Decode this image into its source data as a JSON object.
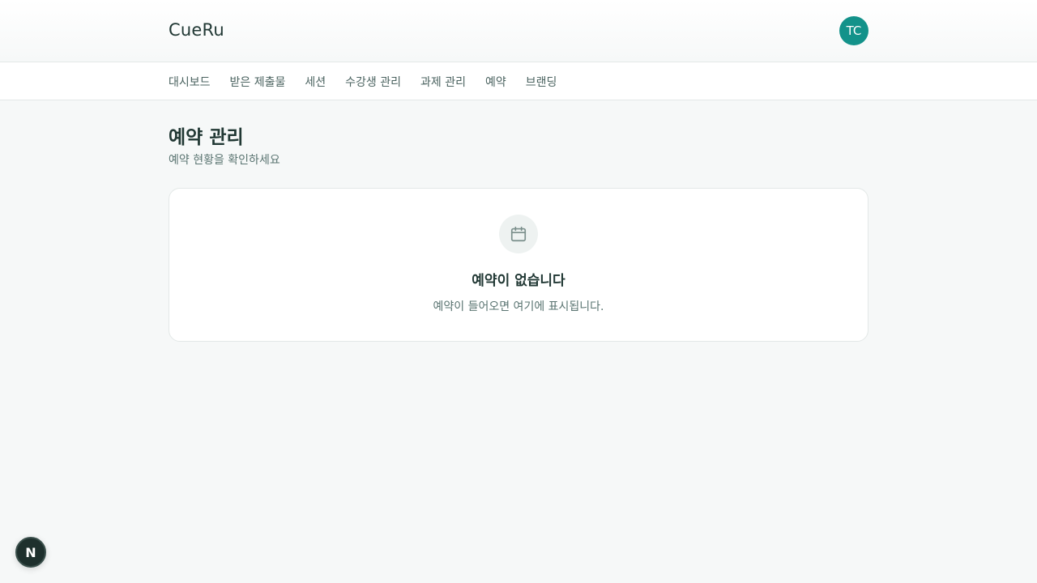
{
  "header": {
    "brand": "CueRu",
    "avatar_initials": "TC"
  },
  "nav": {
    "items": [
      {
        "label": "대시보드"
      },
      {
        "label": "받은 제출물"
      },
      {
        "label": "세션"
      },
      {
        "label": "수강생 관리"
      },
      {
        "label": "과제 관리"
      },
      {
        "label": "예약"
      },
      {
        "label": "브랜딩"
      }
    ]
  },
  "page": {
    "title": "예약 관리",
    "subtitle": "예약 현황을 확인하세요"
  },
  "empty_state": {
    "icon": "calendar-icon",
    "title": "예약이 없습니다",
    "description": "예약이 들어오면 여기에 표시됩니다."
  },
  "floating_button": {
    "label": "N"
  },
  "colors": {
    "accent": "#13928a",
    "background": "#f6f8f8",
    "text_primary": "#213834",
    "text_secondary": "#5a7471"
  }
}
